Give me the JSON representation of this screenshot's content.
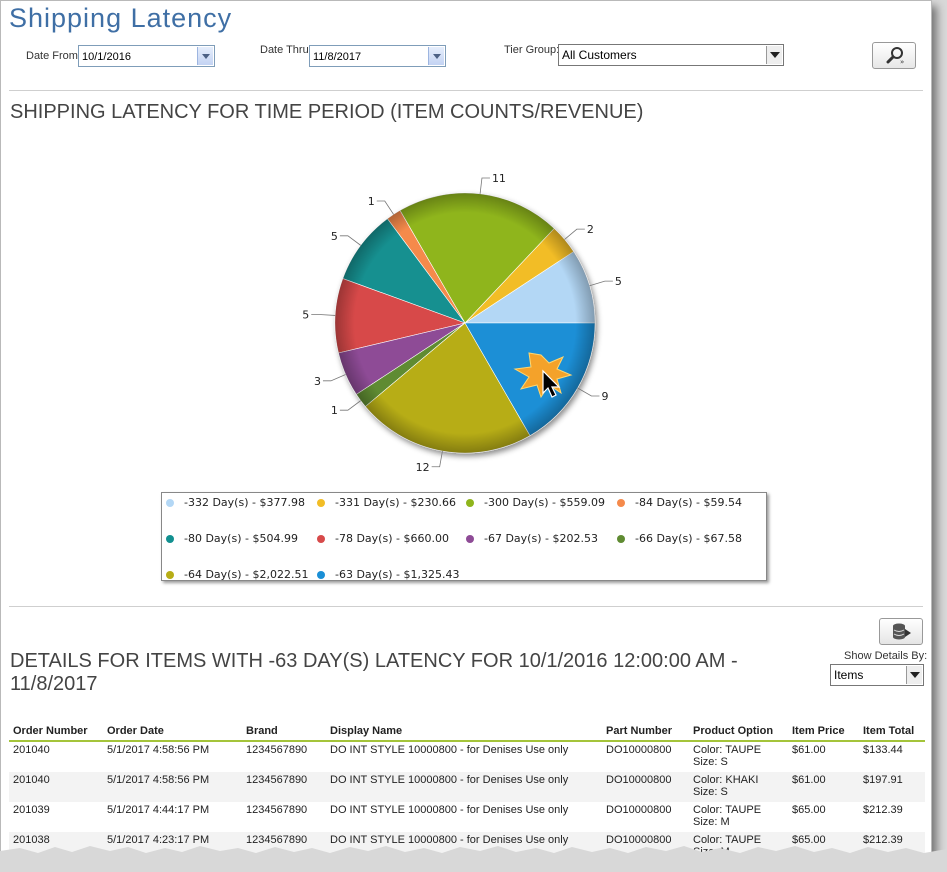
{
  "header": {
    "title": "Shipping Latency"
  },
  "filters": {
    "date_from_label": "Date From",
    "date_from_value": "10/1/2016",
    "date_thru_label": "Date Thru",
    "date_thru_value": "11/8/2017",
    "tier_group_label": "Tier Group:",
    "tier_group_value": "All Customers"
  },
  "chart_section": {
    "title": "SHIPPING LATENCY FOR TIME PERIOD (ITEM COUNTS/REVENUE)"
  },
  "chart_data": {
    "type": "pie",
    "title": "SHIPPING LATENCY FOR TIME PERIOD (ITEM COUNTS/REVENUE)",
    "categories": [
      "-332 Day(s) - $377.98",
      "-331 Day(s) - $230.66",
      "-300 Day(s) - $559.09",
      "-84 Day(s) - $59.54",
      "-80 Day(s) - $504.99",
      "-78 Day(s) - $660.00",
      "-67 Day(s) - $202.53",
      "-66 Day(s) - $67.58",
      "-64 Day(s) - $2,022.51",
      "-63 Day(s) - $1,325.43"
    ],
    "values": [
      5,
      2,
      11,
      1,
      5,
      5,
      3,
      1,
      12,
      9
    ],
    "colors": [
      "#b3d7f5",
      "#f2bd26",
      "#8fb51c",
      "#f58a4b",
      "#129090",
      "#d74a4a",
      "#8e4b96",
      "#5f8b32",
      "#b7ad16",
      "#1a8fd6"
    ],
    "legend_placement": "bottom"
  },
  "details": {
    "title": "DETAILS FOR ITEMS WITH -63 DAY(S) LATENCY FOR 10/1/2016 12:00:00 AM - 11/8/2017",
    "show_details_label": "Show Details By:",
    "show_details_value": "Items",
    "columns": [
      "Order Number",
      "Order Date",
      "Brand",
      "Display Name",
      "Part Number",
      "Product Option",
      "Item Price",
      "Item Total"
    ],
    "rows": [
      [
        "201040",
        "5/1/2017 4:58:56 PM",
        "1234567890",
        "DO INT STYLE 10000800 - for Denises Use only",
        "DO10000800",
        "Color: TAUPE",
        "Size: S",
        "$61.00",
        "$133.44"
      ],
      [
        "201040",
        "5/1/2017 4:58:56 PM",
        "1234567890",
        "DO INT STYLE 10000800 - for Denises Use only",
        "DO10000800",
        "Color: KHAKI",
        "Size: S",
        "$61.00",
        "$197.91"
      ],
      [
        "201039",
        "5/1/2017 4:44:17 PM",
        "1234567890",
        "DO INT STYLE 10000800 - for Denises Use only",
        "DO10000800",
        "Color: TAUPE",
        "Size: M",
        "$65.00",
        "$212.39"
      ],
      [
        "201038",
        "5/1/2017 4:23:17 PM",
        "1234567890",
        "DO INT STYLE 10000800 - for Denises Use only",
        "DO10000800",
        "Color: TAUPE",
        "Size: M",
        "$65.00",
        "$212.39"
      ]
    ]
  }
}
